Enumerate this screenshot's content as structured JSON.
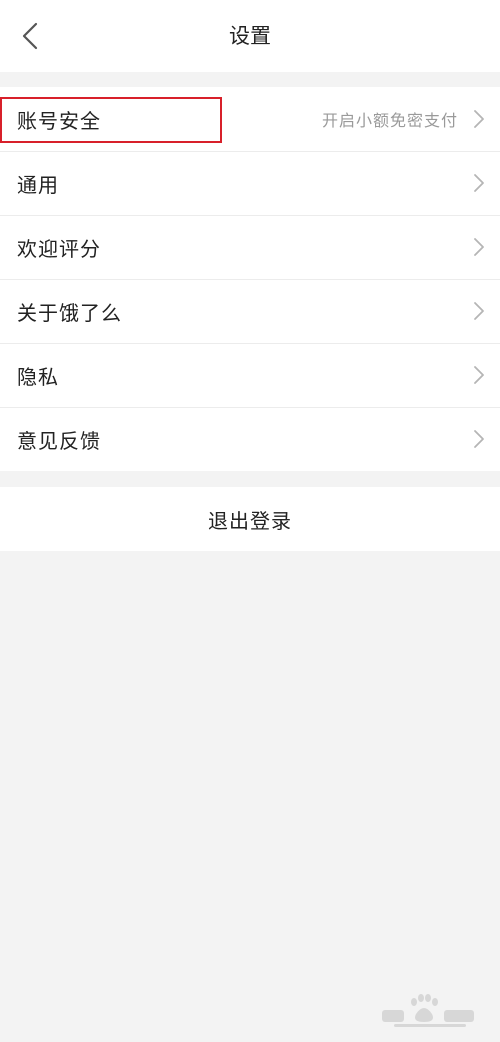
{
  "header": {
    "title": "设置",
    "back_icon": "chevron-left-icon"
  },
  "menu": {
    "items": [
      {
        "label": "账号安全",
        "hint": "开启小额免密支付",
        "icon": "chevron-right-icon"
      },
      {
        "label": "通用",
        "hint": "",
        "icon": "chevron-right-icon"
      },
      {
        "label": "欢迎评分",
        "hint": "",
        "icon": "chevron-right-icon"
      },
      {
        "label": "关于饿了么",
        "hint": "",
        "icon": "chevron-right-icon"
      },
      {
        "label": "隐私",
        "hint": "",
        "icon": "chevron-right-icon"
      },
      {
        "label": "意见反馈",
        "hint": "",
        "icon": "chevron-right-icon"
      }
    ]
  },
  "logout": {
    "label": "退出登录"
  },
  "annotation": {
    "highlight_color": "#d8202a"
  },
  "watermark": {
    "icon": "baidu-paw-logo"
  },
  "colors": {
    "background": "#f3f3f3",
    "card": "#ffffff",
    "hint_text": "#9a9a9a",
    "chevron": "#b5b5b5"
  }
}
